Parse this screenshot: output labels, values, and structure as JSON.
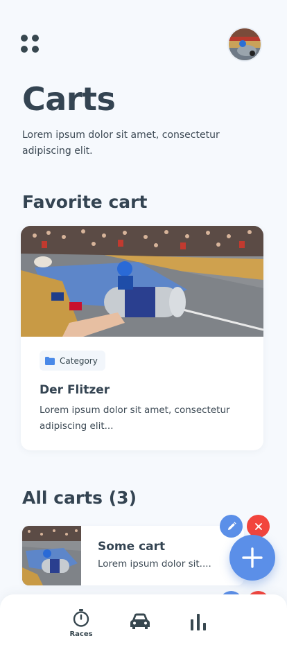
{
  "header": {
    "menu_icon": "grid-dots-icon",
    "avatar_icon": "user-avatar-photo"
  },
  "page": {
    "title": "Carts",
    "description": "Lorem ipsum dolor sit amet, consectetur adipiscing elit."
  },
  "favorite": {
    "section_title": "Favorite cart",
    "category_label": "Category",
    "category_icon": "folder-icon",
    "name": "Der Flitzer",
    "description": "Lorem ipsum dolor sit amet, consectetur adipiscing elit..."
  },
  "all_carts": {
    "section_title": "All carts (3)",
    "items": [
      {
        "name": "Some cart",
        "description": "Lorem ipsum dolor sit...."
      }
    ]
  },
  "actions": {
    "edit_icon": "pencil-icon",
    "delete_icon": "close-icon",
    "add_icon": "plus-icon"
  },
  "bottom_nav": {
    "items": [
      {
        "label": "Races",
        "icon": "stopwatch-icon"
      },
      {
        "label": "",
        "icon": "car-icon"
      },
      {
        "label": "",
        "icon": "bar-chart-icon"
      }
    ]
  },
  "colors": {
    "accent": "#5b8fe8",
    "danger": "#f2453d",
    "background": "#f6f9fd",
    "text": "#344452"
  }
}
